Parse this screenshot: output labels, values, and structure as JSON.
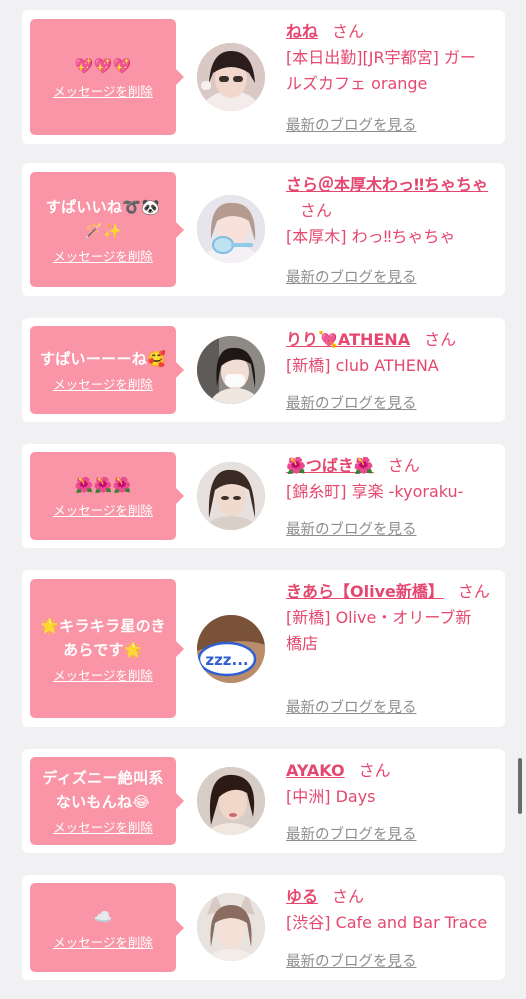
{
  "theme": {
    "accent": "#e5486f",
    "bubble": "#f995a6",
    "card": "#ffffff",
    "background": "#f1f1f3",
    "link_gray": "#8e8e8e"
  },
  "entries": [
    {
      "message": "💖💖💖",
      "delete_label": "メッセージを削除",
      "name": "ねね",
      "suffix": "さん",
      "shop": "[本日出勤][JR宇都宮] ガールズカフェ orange",
      "blog_label": "最新のブログを見る"
    },
    {
      "message": "すぱいいね➰🐼🪄✨",
      "delete_label": "メッセージを削除",
      "name": "さら＠本厚木わっ‼ちゃちゃ",
      "suffix": "さん",
      "shop": "[本厚木] わっ‼ちゃちゃ",
      "blog_label": "最新のブログを見る"
    },
    {
      "message": "すぱいーーーね🥰",
      "delete_label": "メッセージを削除",
      "name": "りり💘ATHENA",
      "suffix": "さん",
      "shop": "[新橋] club ATHENA",
      "blog_label": "最新のブログを見る"
    },
    {
      "message": "🌺🌺🌺",
      "delete_label": "メッセージを削除",
      "name": "🌺つばき🌺",
      "suffix": "さん",
      "shop": "[錦糸町] 享楽 -kyoraku-",
      "blog_label": "最新のブログを見る"
    },
    {
      "message": "🌟キラキラ星のきあらです🌟",
      "delete_label": "メッセージを削除",
      "name": "きあら【Olive新橋】",
      "suffix": "さん",
      "shop": "[新橋] Olive・オリーブ新橋店",
      "blog_label": "最新のブログを見る",
      "avatar_text": "zzz..."
    },
    {
      "message": "ディズニー絶叫系ないもんね😂",
      "delete_label": "メッセージを削除",
      "name": "AYAKO",
      "suffix": "さん",
      "shop": "[中洲] Days",
      "blog_label": "最新のブログを見る"
    },
    {
      "message": "☁️",
      "delete_label": "メッセージを削除",
      "name": "ゆる",
      "suffix": "さん",
      "shop": "[渋谷] Cafe and Bar Trace",
      "blog_label": "最新のブログを見る"
    }
  ]
}
